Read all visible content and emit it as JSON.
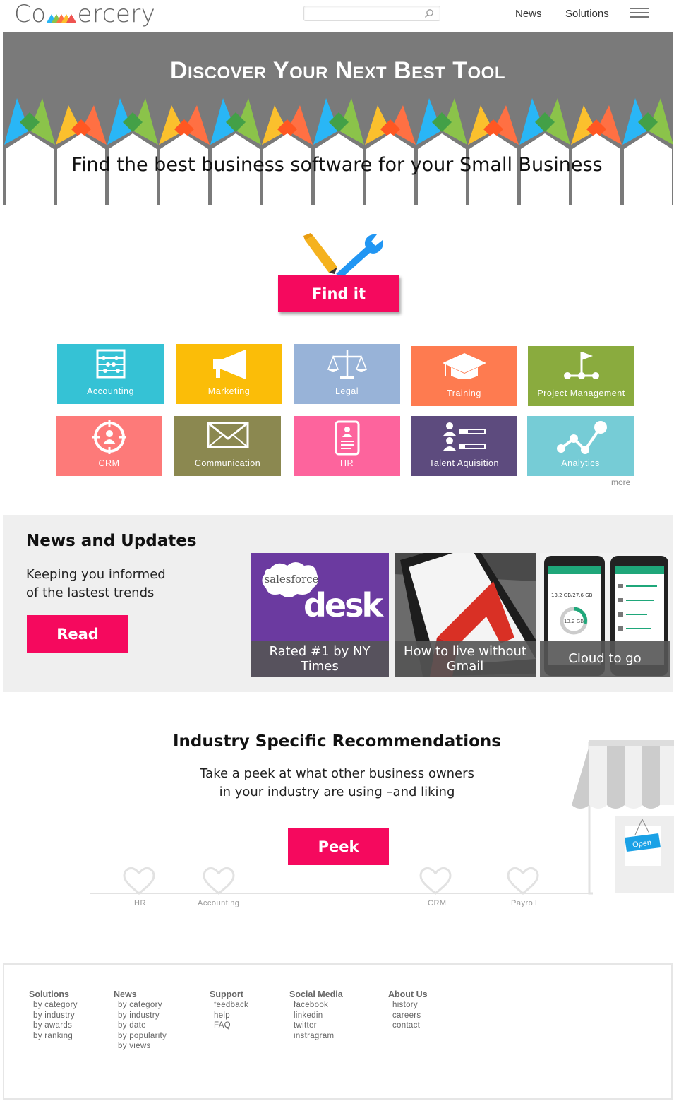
{
  "header": {
    "logo_text_left": "Co",
    "logo_text_right": "ercery",
    "search_placeholder": "",
    "nav": [
      "News",
      "Solutions"
    ]
  },
  "hero": {
    "title": "Discover Your Next Best Tool",
    "subtitle": "Find the best business software for your Small Business"
  },
  "find_button": "Find it",
  "categories": [
    {
      "label": "Accounting",
      "color": "#35c2d5",
      "icon": "abacus-icon"
    },
    {
      "label": "Marketing",
      "color": "#fbbd08",
      "icon": "megaphone-icon"
    },
    {
      "label": "Legal",
      "color": "#98b3d8",
      "icon": "scales-icon"
    },
    {
      "label": "Training",
      "color": "#fe7b50",
      "icon": "graduation-cap-icon"
    },
    {
      "label": "Project Management",
      "color": "#8aab3e",
      "icon": "flag-network-icon"
    },
    {
      "label": "CRM",
      "color": "#fd7a79",
      "icon": "target-person-icon"
    },
    {
      "label": "Communication",
      "color": "#8b8850",
      "icon": "envelope-icon"
    },
    {
      "label": "HR",
      "color": "#fd649d",
      "icon": "id-card-icon"
    },
    {
      "label": "Talent Aquisition",
      "color": "#5d4b7e",
      "icon": "people-list-icon"
    },
    {
      "label": "Analytics",
      "color": "#76ccd6",
      "icon": "nodes-icon"
    }
  ],
  "more_label": "more",
  "news": {
    "title": "News and Updates",
    "description": "Keeping you informed of the lastest trends",
    "read_button": "Read",
    "cards": [
      {
        "caption": "Rated #1 by NY Times",
        "image_text_1": "salesforce",
        "image_text_2": "desk"
      },
      {
        "caption": "How to live without Gmail"
      },
      {
        "caption": "Cloud to go",
        "phone_1_text": "13.2 GB/27.6 GB",
        "phone_2_text": "13.2 GB"
      }
    ]
  },
  "industry": {
    "title": "Industry Specific Recommendations",
    "description_line1": "Take a peek at what other business owners",
    "description_line2": "in your industry are using –and liking",
    "peek_button": "Peek",
    "store_sign": "Open",
    "hearts": [
      "HR",
      "Accounting",
      "CRM",
      "Payroll"
    ]
  },
  "footer": {
    "columns": [
      {
        "title": "Solutions",
        "items": [
          "by category",
          "by industry",
          "by awards",
          "by ranking"
        ]
      },
      {
        "title": "News",
        "items": [
          "by category",
          "by industry",
          "by date",
          "by popularity",
          "by views"
        ]
      },
      {
        "title": "Support",
        "items": [
          "feedback",
          "help",
          "FAQ"
        ]
      },
      {
        "title": "Social Media",
        "items": [
          "facebook",
          "linkedin",
          "twitter",
          "instragram"
        ]
      },
      {
        "title": "About Us",
        "items": [
          "history",
          "careers",
          "contact"
        ]
      }
    ]
  },
  "colors": {
    "accent": "#f5095e",
    "hero_bg": "#7a7a7a",
    "news_bg": "#efefef"
  }
}
